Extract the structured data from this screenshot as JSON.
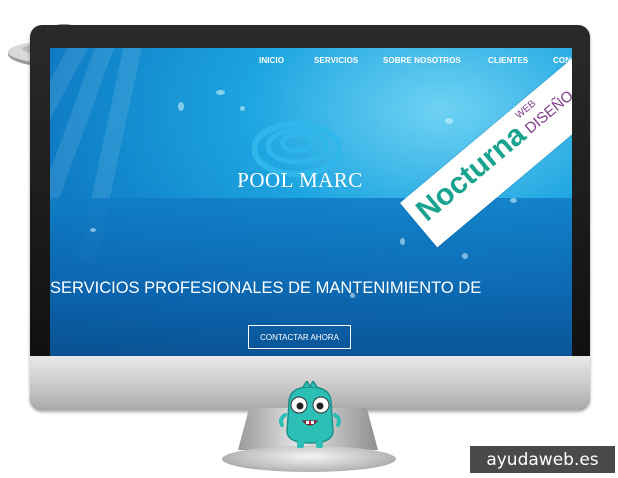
{
  "nav": {
    "items": [
      {
        "label": "INICIO"
      },
      {
        "label": "SERVICIOS"
      },
      {
        "label": "SOBRE NOSOTROS"
      },
      {
        "label": "CLIENTES"
      },
      {
        "label": "CON"
      }
    ]
  },
  "hero": {
    "brand": "POOL MARC",
    "headline": "SERVICIOS PROFESIONALES DE MANTENIMIENTO DE",
    "cta_label": "CONTACTAR AHORA"
  },
  "ribbon": {
    "main": "Nocturna",
    "sub1": "WEB",
    "sub2": "DISEÑO"
  },
  "watermark": "ayudaweb.es",
  "colors": {
    "water": "#1da5e0",
    "ribbon_green": "#1aa38f",
    "ribbon_purple": "#7d3c87",
    "mascot": "#2bbfb5"
  },
  "icons": [
    "ufo-icon",
    "water-drop-logo-icon",
    "monster-mascot-icon"
  ]
}
